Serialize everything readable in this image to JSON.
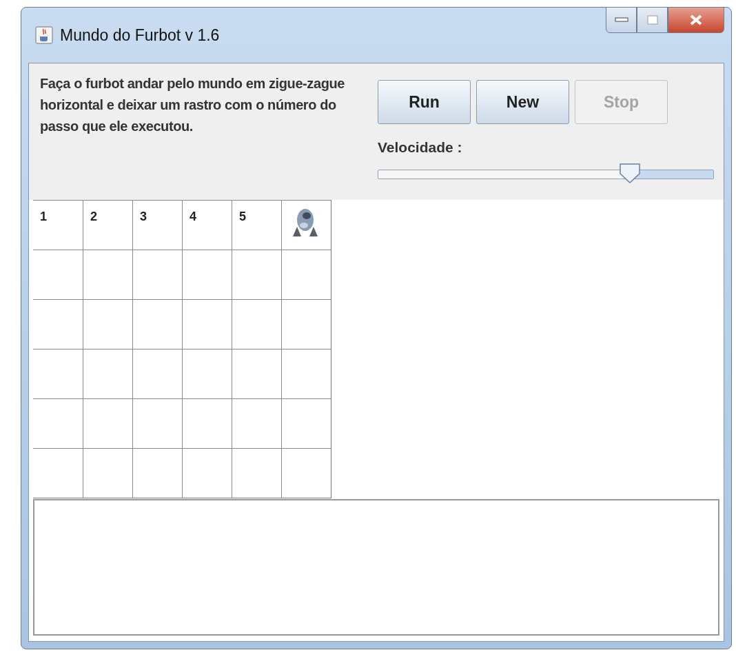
{
  "window": {
    "title": "Mundo do Furbot v 1.6"
  },
  "description": "Faça o furbot andar pelo mundo em zigue-zague horizontal e deixar um rastro com o número do passo que ele executou.",
  "buttons": [
    {
      "label": "Run",
      "disabled": false
    },
    {
      "label": "New",
      "disabled": false
    },
    {
      "label": "Stop",
      "disabled": true
    }
  ],
  "speed": {
    "label": "Velocidade :",
    "level": 0.75
  },
  "grid": {
    "rows": [
      [
        {
          "kind": "number",
          "text": "1"
        },
        {
          "kind": "number",
          "text": "2"
        },
        {
          "kind": "number",
          "text": "3"
        },
        {
          "kind": "number",
          "text": "4"
        },
        {
          "kind": "number",
          "text": "5"
        },
        {
          "kind": "robot"
        }
      ],
      [
        {
          "kind": "empty"
        },
        {
          "kind": "empty"
        },
        {
          "kind": "empty"
        },
        {
          "kind": "empty"
        },
        {
          "kind": "empty"
        },
        {
          "kind": "empty"
        }
      ],
      [
        {
          "kind": "empty"
        },
        {
          "kind": "empty"
        },
        {
          "kind": "empty"
        },
        {
          "kind": "empty"
        },
        {
          "kind": "empty"
        },
        {
          "kind": "empty"
        }
      ],
      [
        {
          "kind": "empty"
        },
        {
          "kind": "empty"
        },
        {
          "kind": "empty"
        },
        {
          "kind": "empty"
        },
        {
          "kind": "empty"
        },
        {
          "kind": "empty"
        }
      ],
      [
        {
          "kind": "empty"
        },
        {
          "kind": "empty"
        },
        {
          "kind": "empty"
        },
        {
          "kind": "empty"
        },
        {
          "kind": "empty"
        },
        {
          "kind": "empty"
        }
      ],
      [
        {
          "kind": "empty"
        },
        {
          "kind": "empty"
        },
        {
          "kind": "empty"
        },
        {
          "kind": "empty"
        },
        {
          "kind": "empty"
        },
        {
          "kind": "empty"
        }
      ]
    ]
  }
}
